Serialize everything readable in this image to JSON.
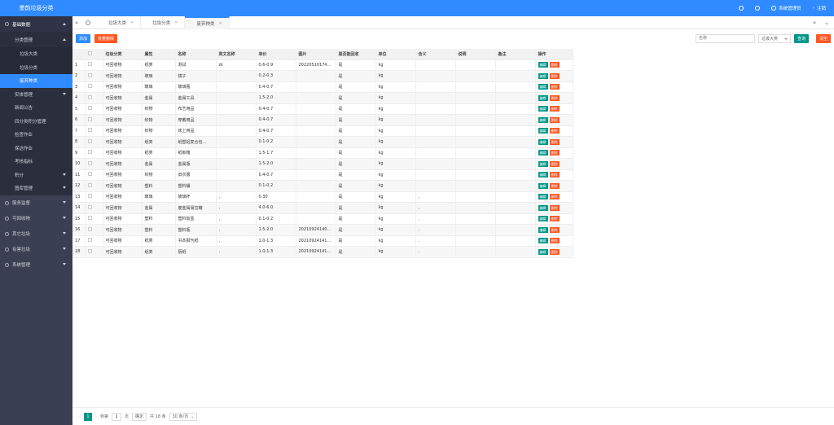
{
  "app": {
    "title": "墨韵垃圾分类"
  },
  "header": {
    "user": "系统管理员",
    "logout": "注销"
  },
  "sidebar": {
    "groups": [
      {
        "label": "基础数据",
        "expanded": true
      },
      {
        "label": "服务监督"
      },
      {
        "label": "可回收物"
      },
      {
        "label": "其它垃圾"
      },
      {
        "label": "有害垃圾"
      },
      {
        "label": "系统管理"
      }
    ],
    "sub_group": "分类管理",
    "sub_items": [
      "垃圾大类",
      "垃圾分类",
      "废弃种类"
    ],
    "items": [
      "实体管理",
      "新闻公告",
      "四分类积分管理",
      "检查作业",
      "保洁作业",
      "考核指标",
      "积分",
      "图库管理"
    ]
  },
  "tabs": [
    {
      "label": "垃圾大类"
    },
    {
      "label": "垃圾分类"
    },
    {
      "label": "废弃种类",
      "active": true
    }
  ],
  "toolbar": {
    "add": "添加",
    "batch_delete": "批量删除",
    "search_placeholder": "名称",
    "filter_value": "垃圾大类",
    "search": "查询",
    "reset": "清空"
  },
  "table": {
    "headers": [
      "",
      "",
      "垃圾分类",
      "属性",
      "名称",
      "英文名称",
      "单价",
      "图片",
      "是否能回收",
      "单位",
      "含义",
      "说明",
      "备注",
      "操作"
    ],
    "edit_label": "编辑",
    "delete_label": "删除",
    "rows": [
      [
        "1",
        "可回收物",
        "纸类",
        "测试",
        "zk",
        "0.6-0.9",
        "20220510174...",
        "是",
        "kg",
        "",
        "",
        ""
      ],
      [
        "2",
        "可回收物",
        "玻璃",
        "镜子",
        "",
        "0.2-0.3",
        "",
        "是",
        "kg",
        "",
        "",
        ""
      ],
      [
        "3",
        "可回收物",
        "玻璃",
        "玻璃瓶",
        "",
        "0.4-0.7",
        "",
        "是",
        "kg",
        "",
        "",
        ""
      ],
      [
        "4",
        "可回收物",
        "金属",
        "金属工具",
        "",
        "1.5-2.0",
        "",
        "是",
        "kg",
        "",
        "",
        ""
      ],
      [
        "5",
        "可回收物",
        "织物",
        "布艺用品",
        "",
        "0.4-0.7",
        "",
        "是",
        "kg",
        "",
        "",
        ""
      ],
      [
        "6",
        "可回收物",
        "织物",
        "穿戴用品",
        "",
        "0.4-0.7",
        "",
        "是",
        "kg",
        "",
        "",
        ""
      ],
      [
        "7",
        "可回收物",
        "织物",
        "床上用品",
        "",
        "0.4-0.7",
        "",
        "是",
        "kg",
        "",
        "",
        ""
      ],
      [
        "8",
        "可回收物",
        "纸类",
        "纸塑铝复合包...",
        "",
        "0.1-0.2",
        "",
        "是",
        "kg",
        "",
        "",
        ""
      ],
      [
        "9",
        "可回收物",
        "纸类",
        "纸板箱",
        "",
        "1.5-1.7",
        "",
        "是",
        "kg",
        "",
        "",
        ""
      ],
      [
        "10",
        "可回收物",
        "金属",
        "金属瓶",
        "",
        "1.5-2.0",
        "",
        "是",
        "kg",
        "",
        "",
        ""
      ],
      [
        "11",
        "可回收物",
        "织物",
        "旧衣服",
        "",
        "0.4-0.7",
        "",
        "是",
        "kg",
        "",
        "",
        ""
      ],
      [
        "12",
        "可回收物",
        "塑料",
        "塑料桶",
        "",
        "0.1-0.2",
        "",
        "是",
        "kg",
        "",
        "",
        ""
      ],
      [
        "13",
        "可回收物",
        "玻璃",
        "玻璃杯",
        ",",
        "0.30",
        "",
        "是",
        "kg",
        ",",
        "",
        ""
      ],
      [
        "14",
        "可回收物",
        "金属",
        "废金属易拉罐",
        ",",
        "4.0-6.0",
        "",
        "是",
        "kg",
        ",",
        "",
        ""
      ],
      [
        "15",
        "可回收物",
        "塑料",
        "塑料饭盒",
        ",",
        "0.1-0.2",
        "",
        "是",
        "kg",
        ",",
        "",
        ""
      ],
      [
        "16",
        "可回收物",
        "塑料",
        "塑料瓶",
        ",",
        "1.5-2.0",
        "20210924140...",
        "是",
        "kg",
        ",",
        "",
        ""
      ],
      [
        "17",
        "可回收物",
        "纸类",
        "书本报刊纸",
        ",",
        "1.0-1.3",
        "20210924141...",
        "是",
        "kg",
        ",",
        "",
        ""
      ],
      [
        "18",
        "可回收物",
        "纸类",
        "厨纸",
        ",",
        "1.0-1.3",
        "20210924141...",
        "是",
        "kg",
        ",",
        "",
        ""
      ]
    ]
  },
  "pager": {
    "current": "1",
    "goto_label": "到第",
    "page_input": "1",
    "page_suffix": "页",
    "confirm": "确定",
    "total": "共 18 条",
    "size": "30 条/页"
  },
  "colors": {
    "brand": "#2f8bff",
    "sidebar": "#3a3f51",
    "edit": "#009688",
    "delete": "#ff5722"
  }
}
